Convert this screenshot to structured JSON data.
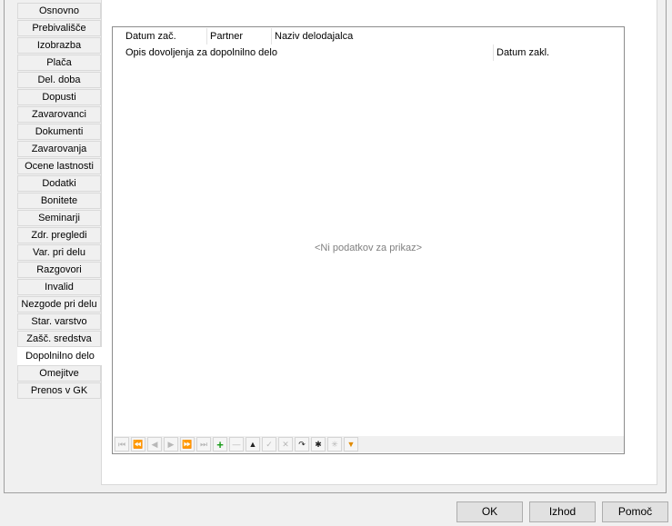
{
  "tabs": [
    "Osnovno",
    "Prebivališče",
    "Izobrazba",
    "Plača",
    "Del. doba",
    "Dopusti",
    "Zavarovanci",
    "Dokumenti",
    "Zavarovanja",
    "Ocene lastnosti",
    "Dodatki",
    "Bonitete",
    "Seminarji",
    "Zdr. pregledi",
    "Var. pri delu",
    "Razgovori",
    "Invalid",
    "Nezgode pri delu",
    "Star. varstvo",
    "Zašč. sredstva",
    "Dopolnilno delo",
    "Omejitve",
    "Prenos v GK"
  ],
  "active_tab": "Dopolnilno delo",
  "grid": {
    "header_row1": [
      "Datum zač.",
      "Partner",
      "Naziv delodajalca"
    ],
    "header_row2": [
      "Opis dovoljenja za dopolnilno delo",
      "Datum zakl."
    ],
    "empty_text": "<Ni podatkov za prikaz>"
  },
  "navigator": [
    {
      "name": "first-record",
      "glyph": "⏮",
      "enabled": false
    },
    {
      "name": "prev-page",
      "glyph": "⏪",
      "enabled": false
    },
    {
      "name": "prev-record",
      "glyph": "◀",
      "enabled": false
    },
    {
      "name": "next-record",
      "glyph": "▶",
      "enabled": false
    },
    {
      "name": "next-page",
      "glyph": "⏩",
      "enabled": false
    },
    {
      "name": "last-record",
      "glyph": "⏭",
      "enabled": false
    },
    {
      "name": "add-record",
      "glyph": "+",
      "enabled": true,
      "style": "green"
    },
    {
      "name": "delete-record",
      "glyph": "—",
      "enabled": false
    },
    {
      "name": "edit-record",
      "glyph": "▲",
      "enabled": true
    },
    {
      "name": "post-edit",
      "glyph": "✓",
      "enabled": false
    },
    {
      "name": "cancel-edit",
      "glyph": "✕",
      "enabled": false
    },
    {
      "name": "refresh",
      "glyph": "↷",
      "enabled": true
    },
    {
      "name": "bookmark",
      "glyph": "✱",
      "enabled": true
    },
    {
      "name": "goto-bookmark",
      "glyph": "✳",
      "enabled": false
    },
    {
      "name": "filter",
      "glyph": "▼",
      "enabled": true,
      "style": "orange"
    }
  ],
  "buttons": {
    "ok": "OK",
    "exit": "Izhod",
    "help": "Pomoč"
  }
}
